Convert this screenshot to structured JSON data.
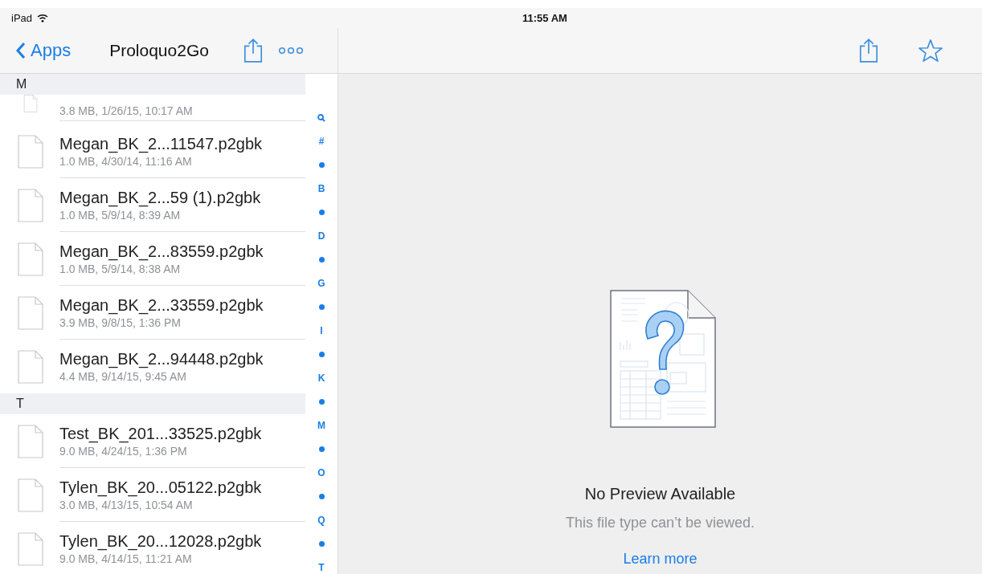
{
  "status_bar": {
    "device": "iPad",
    "time": "11:55 AM"
  },
  "nav": {
    "back": "Apps",
    "title": "Proloquo2Go"
  },
  "sections": [
    {
      "letter": "M",
      "files": [
        {
          "meta": "3.8 MB, 1/26/15, 10:17 AM"
        },
        {
          "name": "Megan_BK_2...11547.p2gbk",
          "meta": "1.0 MB, 4/30/14, 11:16 AM"
        },
        {
          "name": "Megan_BK_2...59 (1).p2gbk",
          "meta": "1.0 MB, 5/9/14, 8:39 AM"
        },
        {
          "name": "Megan_BK_2...83559.p2gbk",
          "meta": "1.0 MB, 5/9/14, 8:38 AM"
        },
        {
          "name": "Megan_BK_2...33559.p2gbk",
          "meta": "3.9 MB, 9/8/15, 1:36 PM"
        },
        {
          "name": "Megan_BK_2...94448.p2gbk",
          "meta": "4.4 MB, 9/14/15, 9:45 AM"
        }
      ]
    },
    {
      "letter": "T",
      "files": [
        {
          "name": "Test_BK_201...33525.p2gbk",
          "meta": "9.0 MB, 4/24/15, 1:36 PM"
        },
        {
          "name": "Tylen_BK_20...05122.p2gbk",
          "meta": "3.0 MB, 4/13/15, 10:54 AM"
        },
        {
          "name": "Tylen_BK_20...12028.p2gbk",
          "meta": "9.0 MB, 4/14/15, 11:21 AM"
        }
      ]
    }
  ],
  "index": [
    {
      "kind": "search"
    },
    {
      "kind": "letter",
      "text": "#"
    },
    {
      "kind": "dot"
    },
    {
      "kind": "letter",
      "text": "B"
    },
    {
      "kind": "dot"
    },
    {
      "kind": "letter",
      "text": "D"
    },
    {
      "kind": "dot"
    },
    {
      "kind": "letter",
      "text": "G"
    },
    {
      "kind": "dot"
    },
    {
      "kind": "letter",
      "text": "I"
    },
    {
      "kind": "dot"
    },
    {
      "kind": "letter",
      "text": "K"
    },
    {
      "kind": "dot"
    },
    {
      "kind": "letter",
      "text": "M"
    },
    {
      "kind": "dot"
    },
    {
      "kind": "letter",
      "text": "O"
    },
    {
      "kind": "dot"
    },
    {
      "kind": "letter",
      "text": "Q"
    },
    {
      "kind": "dot"
    },
    {
      "kind": "letter",
      "text": "T"
    }
  ],
  "preview": {
    "title": "No Preview Available",
    "message": "This file type can’t be viewed.",
    "link": "Learn more"
  }
}
